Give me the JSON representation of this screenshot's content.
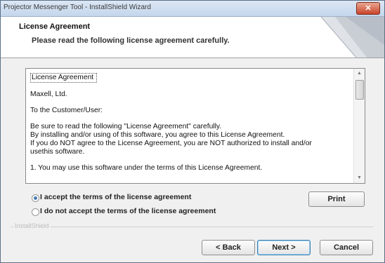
{
  "window": {
    "title": "Projector Messenger Tool - InstallShield Wizard",
    "close_label": "✕"
  },
  "header": {
    "title": "License Agreement",
    "subtitle": "Please read the following license agreement carefully."
  },
  "license": {
    "lines": [
      "License Agreement",
      "Maxell, Ltd.",
      "To the Customer/User:",
      "Be sure to read the following \"License Agreement\" carefully.",
      "By installing and/or using of this software, you agree to this License Agreement.",
      "If you do NOT agree to the License Agreement, you are NOT authorized to install and/or",
      "usethis software.",
      "1. You may use this software under the terms of this License Agreement."
    ]
  },
  "options": {
    "accept_label": "I accept the terms of the license agreement",
    "decline_label": "I do not accept the terms of the license agreement",
    "selected": "accept"
  },
  "buttons": {
    "print": "Print",
    "back": "< Back",
    "next": "Next >",
    "cancel": "Cancel"
  },
  "footer": {
    "installshield": "InstallShield"
  }
}
